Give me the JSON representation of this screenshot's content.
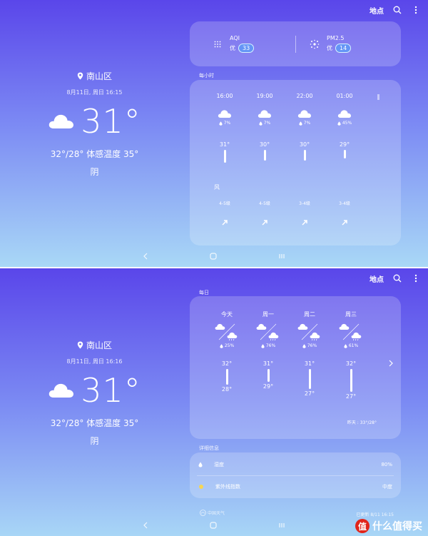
{
  "top": {
    "place_button": "地点",
    "location": "南山区",
    "date": "8月11日, 周日 16:15",
    "temp": "31°",
    "range": "32°/28° 体感温度 35°",
    "condition": "阴",
    "aqi": {
      "label": "AQI",
      "level": "优",
      "value": "33"
    },
    "pm25": {
      "label": "PM2.5",
      "level": "优",
      "value": "14"
    },
    "hourly_label": "每小时",
    "hourly": [
      {
        "time": "16:00",
        "precip": "7%",
        "temp": "31°",
        "bar": 18,
        "wind": "4-5级"
      },
      {
        "time": "19:00",
        "precip": "7%",
        "temp": "30°",
        "bar": 15,
        "wind": "4-5级"
      },
      {
        "time": "22:00",
        "precip": "7%",
        "temp": "30°",
        "bar": 15,
        "wind": "3-4级"
      },
      {
        "time": "01:00",
        "precip": "45%",
        "temp": "29°",
        "bar": 12,
        "wind": "3-4级"
      }
    ],
    "wind_label": "风"
  },
  "bottom": {
    "place_button": "地点",
    "location": "南山区",
    "date": "8月11日, 周日 16:16",
    "temp": "31°",
    "range": "32°/28° 体感温度 35°",
    "condition": "阴",
    "daily_label": "每日",
    "daily": [
      {
        "day": "今天",
        "precip": "25%",
        "high": "32°",
        "low": "28°",
        "bar": 22
      },
      {
        "day": "周一",
        "precip": "76%",
        "high": "31°",
        "low": "29°",
        "bar": 18
      },
      {
        "day": "周二",
        "precip": "76%",
        "high": "31°",
        "low": "27°",
        "bar": 28
      },
      {
        "day": "周三",
        "precip": "61%",
        "high": "32°",
        "low": "27°",
        "bar": 32
      }
    ],
    "yesterday": "昨天 : 33°/28°",
    "detail_label": "详细信息",
    "details": [
      {
        "label": "湿度",
        "value": "80%"
      },
      {
        "label": "紫外线指数",
        "value": "中度"
      }
    ],
    "update_time": "已更新 8/11 16:15",
    "weather_logo": "中国天气",
    "watermark": "什么值得买",
    "watermark_mark": "值"
  }
}
